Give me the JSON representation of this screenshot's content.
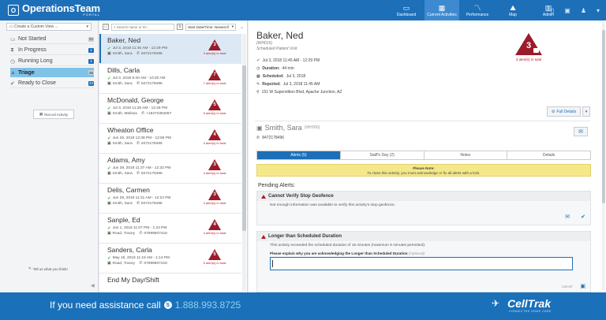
{
  "app": {
    "logo_mark": "O",
    "logo_name": "OperationsTeam",
    "logo_sub": "PORTAL"
  },
  "nav": [
    {
      "label": "Dashboard",
      "icon": "monitor-icon",
      "glyph": "▭"
    },
    {
      "label": "Current Activities",
      "icon": "calendar-icon",
      "glyph": "▦",
      "active": true
    },
    {
      "label": "Performance",
      "icon": "chart-icon",
      "glyph": "〽"
    },
    {
      "label": "Map",
      "icon": "map-icon",
      "glyph": "⛰"
    },
    {
      "label": "Admin",
      "icon": "admin-icon",
      "glyph": "▥"
    }
  ],
  "header_icons": [
    "▯",
    "▣",
    "♟",
    "▾"
  ],
  "sidebar": {
    "custom_view_placeholder": "Create a Custom View ...",
    "statuses": [
      {
        "label": "Not Started",
        "glyph": "▭",
        "count": "50",
        "gray": true
      },
      {
        "label": "In Progress",
        "glyph": "⧗",
        "count": "1"
      },
      {
        "label": "Running Long",
        "glyph": "◷",
        "count": "1"
      },
      {
        "label": "Triage",
        "glyph": "▲",
        "count": "26",
        "gray": true,
        "active": true
      },
      {
        "label": "Ready to Close",
        "glyph": "✔",
        "count": "24"
      }
    ],
    "record_activity": "Record Activity",
    "tell_us": "Tell us what you think!"
  },
  "list": {
    "search_placeholder": "Search name or ID...",
    "sort_label": "Start Date/Time: Newest fi",
    "items": [
      {
        "name": "Baker, Ned",
        "time": "Jul 3, 2018 11:45 AM - 12:29 PM",
        "staff": "Smith, Sara",
        "phone": "8472178496",
        "alerts": "3",
        "alert_text": "3 alert(s) in total",
        "selected": true
      },
      {
        "name": "Dills, Carla",
        "time": "Jul 3, 2018 9:40 AM - 10:20 AM",
        "staff": "Smith, Sara",
        "phone": "8472178496",
        "alerts": "7",
        "alert_text": "7 alert(s) in total"
      },
      {
        "name": "McDonald, George",
        "time": "Jul 3, 2018 11:28 AM - 12:28 PM",
        "staff": "Smith, Melissa",
        "phone": "+18472384067",
        "alerts": "5",
        "alert_text": "5 alert(s) in total"
      },
      {
        "name": "Wheaton Office",
        "time": "Jun 29, 2018 12:38 PM - 12:59 PM",
        "staff": "Smith, Sara",
        "phone": "8472178496",
        "alerts": "4",
        "alert_text": "4 alert(s) in total"
      },
      {
        "name": "Adams, Amy",
        "time": "Jun 29, 2018 11:37 AM - 12:32 PM",
        "staff": "Smith, Sara",
        "phone": "8472178496",
        "alerts": "3",
        "alert_text": "3 alert(s) in total"
      },
      {
        "name": "Delis, Carmen",
        "time": "Jun 29, 2018 11:31 AM - 12:10 PM",
        "staff": "Smith, Sara",
        "phone": "8472178496",
        "alerts": "3",
        "alert_text": "3 alert(s) in total"
      },
      {
        "name": "Sanple, Ed",
        "time": "Jun 1, 2018 11:07 PM - 1:23 PM",
        "staff": "Road, Tracey",
        "phone": "07899607418",
        "alerts": "4",
        "alert_text": "4 alert(s) in total"
      },
      {
        "name": "Sanders, Carla",
        "time": "May 15, 2018 11:15 AM - 1:14 PM",
        "staff": "Road, Tracey",
        "phone": "07899607418",
        "alerts": "5",
        "alert_text": "5 alert(s) in total"
      },
      {
        "name": "End My Day/Shift",
        "time": "",
        "staff": "",
        "phone": "",
        "alerts": "",
        "alert_text": ""
      }
    ]
  },
  "detail": {
    "name": "Baker, Ned",
    "id": "(WH015)",
    "type": "Scheduled Patient Visit",
    "time": "Jul 3, 2018 11:45 AM - 12:29 PM",
    "duration_label": "Duration:",
    "duration": "44 min",
    "scheduled_label": "Scheduled:",
    "scheduled": "Jul 3, 2018",
    "reported_label": "Reported:",
    "reported": "Jul 3, 2018 11:45 AM",
    "address": "151 W Superstition Blvd, Apache Junction, AZ",
    "alert_count": "3",
    "alert_total": "3 alert(s) in total",
    "full_details": "Full Details",
    "client_name": "Smith, Sara",
    "client_id": "(WH006)",
    "client_phone": "8472178496",
    "tabs": [
      {
        "label": "Alerts (5)",
        "active": true
      },
      {
        "label": "Staff's Day (2)"
      },
      {
        "label": "Notes"
      },
      {
        "label": "Details"
      }
    ],
    "note_title": "Please Note:",
    "note_text": "To close this activity, you must acknowledge or fix all alerts with a lock.",
    "pending_title": "Pending Alerts:",
    "alerts": [
      {
        "title": "Cannot Verify Stop Geofence",
        "body": "Not enough information was available to verify this activity's stop geofence."
      },
      {
        "title": "Longer than Scheduled Duration",
        "body": "This activity exceeded the scheduled duration of 15 minutes (maximum 5 minutes permitted).",
        "ack_label": "Please explain why you are acknowledging the Longer than Scheduled Duration",
        "ack_optional": "(Optional)",
        "cancel": "cancel"
      }
    ]
  },
  "footer": {
    "assist_text": "If you need assistance call",
    "phone": "1.888.993.8725",
    "brand": "CellTrak",
    "brand_sub": "CONNECTED HOME CARE"
  }
}
